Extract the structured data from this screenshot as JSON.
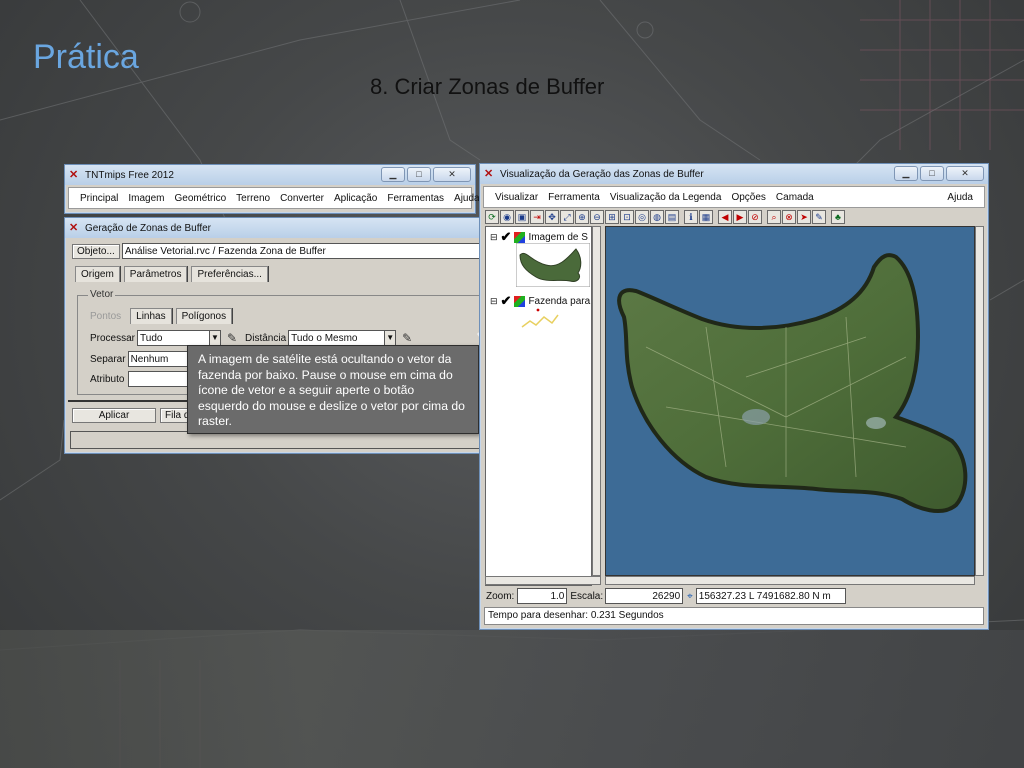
{
  "slide": {
    "title": "Prática",
    "subtitle": "8. Criar Zonas de Buffer"
  },
  "window_main": {
    "title": "TNTmips Free 2012",
    "menu": [
      "Principal",
      "Imagem",
      "Geométrico",
      "Terreno",
      "Converter",
      "Aplicação",
      "Ferramentas",
      "Ajuda"
    ]
  },
  "window_buffer": {
    "title": "Geração de Zonas de Buffer",
    "object_button": "Objeto...",
    "object_path": "Análise Vetorial.rvc / Fazenda Zona de Buffer",
    "tabs": [
      "Origem",
      "Parâmetros",
      "Preferências..."
    ],
    "group_label": "Vetor",
    "element_tabs": [
      "Pontos",
      "Linhas",
      "Polígonos"
    ],
    "processar_label": "Processar",
    "processar_value": "Tudo",
    "distancia_label": "Distância",
    "distancia_value": "Tudo o Mesmo",
    "separar_label": "Separar",
    "separar_value": "Nenhum",
    "atributo_label": "Atributo",
    "aplicar_button": "Aplicar",
    "fila_button": "Fila de"
  },
  "callout": {
    "text": "A imagem de satélite está ocultando o vetor da fazenda por baixo. Pause o mouse em cima do ícone de vetor e a seguir aperte o botão esquerdo do mouse e deslize o vetor por cima do raster."
  },
  "window_view": {
    "title": "Visualização da Geração das Zonas de Buffer",
    "menu": [
      "Visualizar",
      "Ferramenta",
      "Visualização da Legenda",
      "Opções",
      "Camada"
    ],
    "help": "Ajuda",
    "layers": [
      "Imagem de S",
      "Fazenda para"
    ],
    "zoom_label": "Zoom:",
    "zoom_value": "1.0",
    "escala_label": "Escala:",
    "escala_value": "26290",
    "coords": "156327.23 L 7491682.80 N m",
    "status": "Tempo para desenhar: 0.231 Segundos"
  },
  "colors": {
    "title_blue": "#6aa6e0",
    "window_face": "#d4d0c8",
    "view_water": "#3d6b96",
    "callout_bg": "#6b6b6b"
  }
}
